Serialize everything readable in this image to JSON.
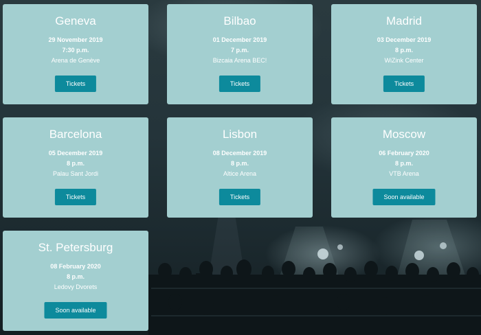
{
  "concerts": [
    {
      "city": "Geneva",
      "date": "29 November 2019",
      "time": "7:30 p.m.",
      "venue": "Arena de Genève",
      "button": "Tickets"
    },
    {
      "city": "Bilbao",
      "date": "01 December 2019",
      "time": "7 p.m.",
      "venue": "Bizcaia Arena BEC!",
      "button": "Tickets"
    },
    {
      "city": "Madrid",
      "date": "03 December 2019",
      "time": "8 p.m.",
      "venue": "WiZink Center",
      "button": "Tickets"
    },
    {
      "city": "Barcelona",
      "date": "05 December 2019",
      "time": "8 p.m.",
      "venue": "Palau Sant Jordi",
      "button": "Tickets"
    },
    {
      "city": "Lisbon",
      "date": "08 December 2019",
      "time": "8 p.m.",
      "venue": "Altice Arena",
      "button": "Tickets"
    },
    {
      "city": "Moscow",
      "date": "06 February 2020",
      "time": "8 p.m.",
      "venue": "VTB Arena",
      "button": "Soon available"
    },
    {
      "city": "St. Petersburg",
      "date": "08 February 2020",
      "time": "8 p.m.",
      "venue": "Ledovy Dvorets",
      "button": "Soon available"
    }
  ],
  "colors": {
    "card_background": "#a3cfd0",
    "button_background": "#0d8a9c",
    "text": "#ffffff"
  }
}
